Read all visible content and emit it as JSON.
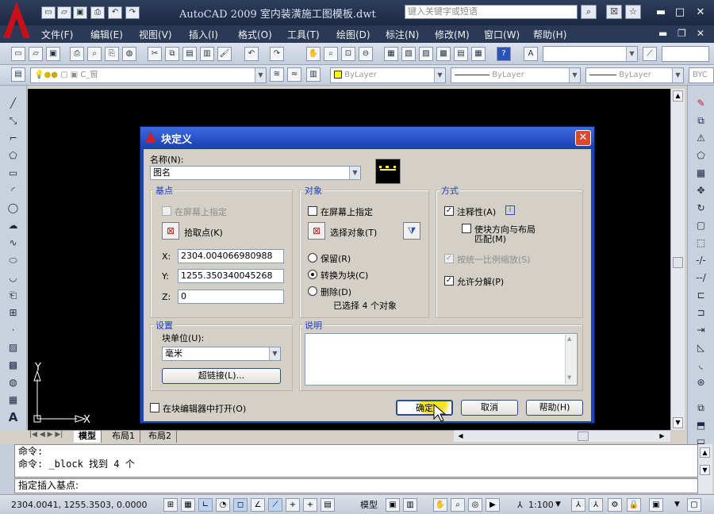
{
  "app": {
    "title": "AutoCAD 2009  室内装潢施工图模板.dwt",
    "search_placeholder": "键入关键字或短语"
  },
  "menus": [
    "文件(F)",
    "编辑(E)",
    "视图(V)",
    "插入(I)",
    "格式(O)",
    "工具(T)",
    "绘图(D)",
    "标注(N)",
    "修改(M)",
    "窗口(W)",
    "帮助(H)"
  ],
  "toolbar2": {
    "layer": "C_窗",
    "color": "ByLayer",
    "linetype": "ByLayer",
    "lineweight": "ByLayer",
    "plotstyle": "BYC"
  },
  "layout_tabs": [
    "模型",
    "布局1",
    "布局2"
  ],
  "dialog": {
    "title": "块定义",
    "name_label": "名称(N):",
    "name_value": "图名",
    "basepoint": {
      "title": "基点",
      "on_screen": "在屏幕上指定",
      "pick_label": "拾取点(K)",
      "x_label": "X:",
      "x_value": "2304.004066980988",
      "y_label": "Y:",
      "y_value": "1255.350340045268",
      "z_label": "Z:",
      "z_value": "0"
    },
    "objects": {
      "title": "对象",
      "on_screen": "在屏幕上指定",
      "select_label": "选择对象(T)",
      "retain": "保留(R)",
      "convert": "转换为块(C)",
      "delete": "删除(D)",
      "selected_info": "已选择 4 个对象"
    },
    "behavior": {
      "title": "方式",
      "annotative": "注释性(A)",
      "match_orient_line1": "使块方向与布局",
      "match_orient_line2": "匹配(M)",
      "uniform_scale": "按统一比例缩放(S)",
      "allow_explode": "允许分解(P)"
    },
    "settings": {
      "title": "设置",
      "unit_label": "块单位(U):",
      "unit_value": "毫米",
      "hyperlink_btn": "超链接(L)..."
    },
    "description": {
      "title": "说明",
      "text": ""
    },
    "open_in_editor": "在块编辑器中打开(O)",
    "ok": "确定",
    "cancel": "取消",
    "help": "帮助(H)"
  },
  "command": {
    "line1": "命令:",
    "line2": "命令: _block 找到 4 个",
    "prompt": "指定插入基点:"
  },
  "status": {
    "coords": "2304.0041, 1255.3503, 0.0000",
    "model": "模型",
    "scale": "1:100"
  },
  "ucs": {
    "x": "X",
    "y": "Y"
  }
}
